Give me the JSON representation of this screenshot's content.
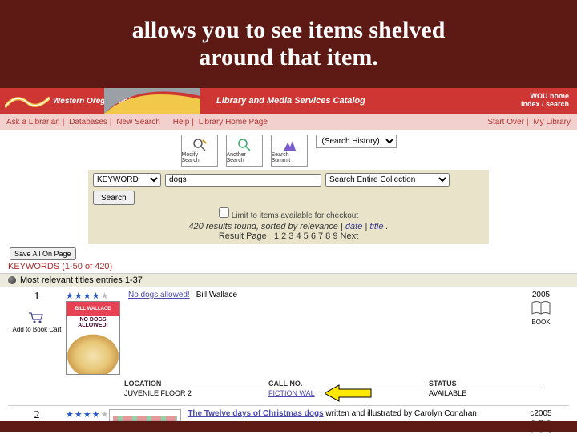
{
  "title_line1": "allows you to see items shelved",
  "title_line2": "around that item.",
  "university": "Western Oregon University",
  "banner_title": "Library and Media Services Catalog",
  "header_right_1": "WOU home",
  "header_right_2": "index / search",
  "nav_left": {
    "ask": "Ask a Librarian",
    "db": "Databases",
    "ns": "New Search"
  },
  "nav_mid": {
    "help": "Help",
    "lib": "Library Home Page"
  },
  "nav_right": {
    "so": "Start Over",
    "ml": "My Library"
  },
  "tools": {
    "modify": "Modify Search",
    "another": "Another Search",
    "summit": "Search Summit"
  },
  "search_hist_label": "(Search History)",
  "search": {
    "kw_options": [
      "KEYWORD"
    ],
    "kw_selected": "KEYWORD",
    "query": "dogs",
    "collection_options": [
      "Search Entire Collection"
    ],
    "collection_selected": "Search Entire Collection",
    "button": "Search",
    "limit_label": "Limit to items available for checkout"
  },
  "results_meta": {
    "count_text": "420 results found, sorted by relevance | ",
    "date_link": "date",
    "title_link": "title",
    "page_label": "Result Page",
    "pages": "1 2 3 4 5 6 7 8 9 Next"
  },
  "save_all": "Save All On Page",
  "kw_heading": "KEYWORDS (1-50 of 420)",
  "relev_heading": "Most relevant titles entries 1-37",
  "add_cart": "Add to Book Cart",
  "loc_headers": {
    "loc": "LOCATION",
    "call": "CALL NO.",
    "status": "STATUS"
  },
  "book_type": "BOOK",
  "entries": [
    {
      "num": "1",
      "title": "No dogs allowed!",
      "author": "Bill Wallace",
      "year": "2005",
      "cover_author": "BILL WALLACE",
      "cover_title": "NO DOGS ALLOWED!",
      "location": "JUVENILE FLOOR 2",
      "callno": "FICTION WAL",
      "status": "AVAILABLE"
    },
    {
      "num": "2",
      "title": "The Twelve days of Christmas dogs",
      "author": "written and illustrated by Carolyn Conahan",
      "year": "c2005"
    }
  ],
  "chart_data": null
}
